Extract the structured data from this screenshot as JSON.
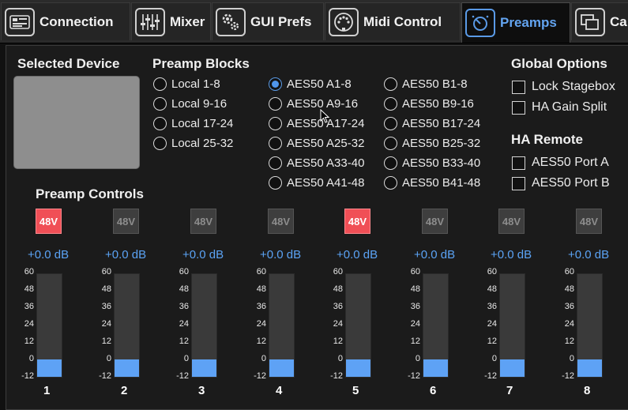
{
  "tabs": [
    {
      "label": "Connection",
      "icon": "connection-icon",
      "active": false
    },
    {
      "label": "Mixer",
      "icon": "mixer-faders-icon",
      "active": false
    },
    {
      "label": "GUI Prefs",
      "icon": "gears-icon",
      "active": false
    },
    {
      "label": "Midi Control",
      "icon": "midi-din-icon",
      "active": false
    },
    {
      "label": "Preamps",
      "icon": "preamp-knob-icon",
      "active": true
    },
    {
      "label": "Ca",
      "icon": "windows-icon",
      "active": false
    }
  ],
  "selected_device": {
    "title": "Selected Device"
  },
  "preamp_blocks": {
    "title": "Preamp Blocks",
    "options": [
      "Local 1-8",
      "Local 9-16",
      "Local 17-24",
      "Local 25-32",
      "AES50 A1-8",
      "AES50 A9-16",
      "AES50 A17-24",
      "AES50 A25-32",
      "AES50 A33-40",
      "AES50 A41-48",
      "AES50 B1-8",
      "AES50 B9-16",
      "AES50 B17-24",
      "AES50 B25-32",
      "AES50 B33-40",
      "AES50 B41-48"
    ],
    "selected": "AES50 A1-8"
  },
  "global_options": {
    "title": "Global Options",
    "items": [
      {
        "label": "Lock Stagebox",
        "checked": false
      },
      {
        "label": "HA Gain Split",
        "checked": false
      }
    ]
  },
  "ha_remote": {
    "title": "HA Remote",
    "items": [
      {
        "label": "AES50 Port A",
        "checked": false
      },
      {
        "label": "AES50 Port B",
        "checked": false
      }
    ]
  },
  "preamp_controls": {
    "title": "Preamp Controls",
    "phantom_label": "48V",
    "scale_labels": [
      "60",
      "48",
      "36",
      "24",
      "12",
      "0",
      "-12"
    ],
    "channels": [
      {
        "number": "1",
        "phantom": true,
        "gain": "+0.0 dB",
        "level": 0.167
      },
      {
        "number": "2",
        "phantom": false,
        "gain": "+0.0 dB",
        "level": 0.167
      },
      {
        "number": "3",
        "phantom": false,
        "gain": "+0.0 dB",
        "level": 0.167
      },
      {
        "number": "4",
        "phantom": false,
        "gain": "+0.0 dB",
        "level": 0.167
      },
      {
        "number": "5",
        "phantom": true,
        "gain": "+0.0 dB",
        "level": 0.167
      },
      {
        "number": "6",
        "phantom": false,
        "gain": "+0.0 dB",
        "level": 0.167
      },
      {
        "number": "7",
        "phantom": false,
        "gain": "+0.0 dB",
        "level": 0.167
      },
      {
        "number": "8",
        "phantom": false,
        "gain": "+0.0 dB",
        "level": 0.167
      }
    ]
  },
  "colors": {
    "accent": "#5ba3f5",
    "phantom_on": "#f04f56",
    "phantom_off": "#3e3e3e",
    "device_box": "#8e8e8e"
  }
}
